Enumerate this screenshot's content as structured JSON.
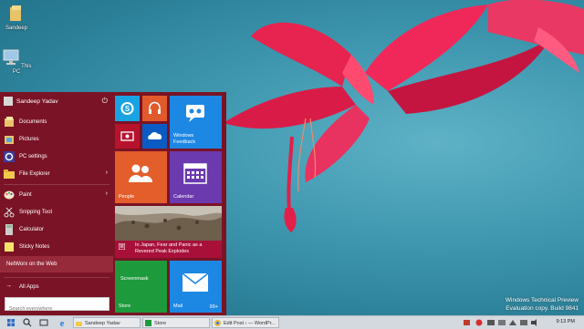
{
  "desktop": {
    "icons": [
      {
        "label": "Sandeep",
        "icon": "user-folder-icon"
      },
      {
        "label": "This PC",
        "icon": "computer-icon"
      }
    ]
  },
  "start_menu": {
    "user_name": "Sandeep Yadav",
    "power_icon": "power-icon",
    "items": [
      {
        "label": "Documents",
        "icon": "documents-icon"
      },
      {
        "label": "Pictures",
        "icon": "pictures-icon"
      },
      {
        "label": "PC settings",
        "icon": "settings-gear-icon"
      },
      {
        "label": "File Explorer",
        "icon": "folder-icon",
        "has_submenu": true
      },
      {
        "label": "Paint",
        "icon": "paint-icon",
        "has_submenu": true
      },
      {
        "label": "Snipping Tool",
        "icon": "scissors-icon"
      },
      {
        "label": "Calculator",
        "icon": "calculator-icon"
      },
      {
        "label": "Sticky Notes",
        "icon": "sticky-notes-icon"
      },
      {
        "label": "NetWorx on the Web",
        "icon": "globe-icon",
        "selected": true
      }
    ],
    "all_apps_label": "All Apps",
    "search_placeholder": "Search everywhere",
    "tiles": {
      "skype": {
        "icon": "skype-icon",
        "color": "#19a3e2"
      },
      "music": {
        "icon": "headphones-icon",
        "color": "#e15a2c"
      },
      "video": {
        "icon": "video-icon",
        "color": "#b8132d"
      },
      "onedrive": {
        "icon": "cloud-icon",
        "color": "#0a5bc4"
      },
      "feedback": {
        "label": "Windows Feedback",
        "icon": "feedback-people-icon",
        "color": "#1d87e4"
      },
      "people": {
        "label": "People",
        "icon": "people-icon",
        "color": "#e35e2b"
      },
      "calendar": {
        "label": "Calendar",
        "icon": "calendar-icon",
        "color": "#6b3aae"
      },
      "news": {
        "headline": "In Japan, Fear and Panic as a Revered Peak Explodes",
        "color": "#a8103a"
      },
      "store": {
        "label": "Store",
        "app": "Screenmask",
        "color": "#1d9a3c"
      },
      "mail": {
        "label": "Mail",
        "count": "99+",
        "icon": "mail-icon",
        "color": "#1d87e4"
      }
    }
  },
  "taskbar": {
    "start_icon": "windows-logo-icon",
    "search_icon": "search-icon",
    "pinned": [
      "task-view-icon",
      "ie-icon",
      "file-explorer-icon"
    ],
    "windows": [
      {
        "label": "Sandeep Yadav",
        "icon": "folder-icon"
      },
      {
        "label": "Store",
        "icon": "store-icon"
      },
      {
        "label": "Edit Post ‹ — WordPr...",
        "icon": "chrome-icon"
      }
    ],
    "clock": "9:13 PM"
  },
  "watermark": {
    "line1": "Windows Technical Preview",
    "line2": "Evaluation copy. Build 9841"
  }
}
